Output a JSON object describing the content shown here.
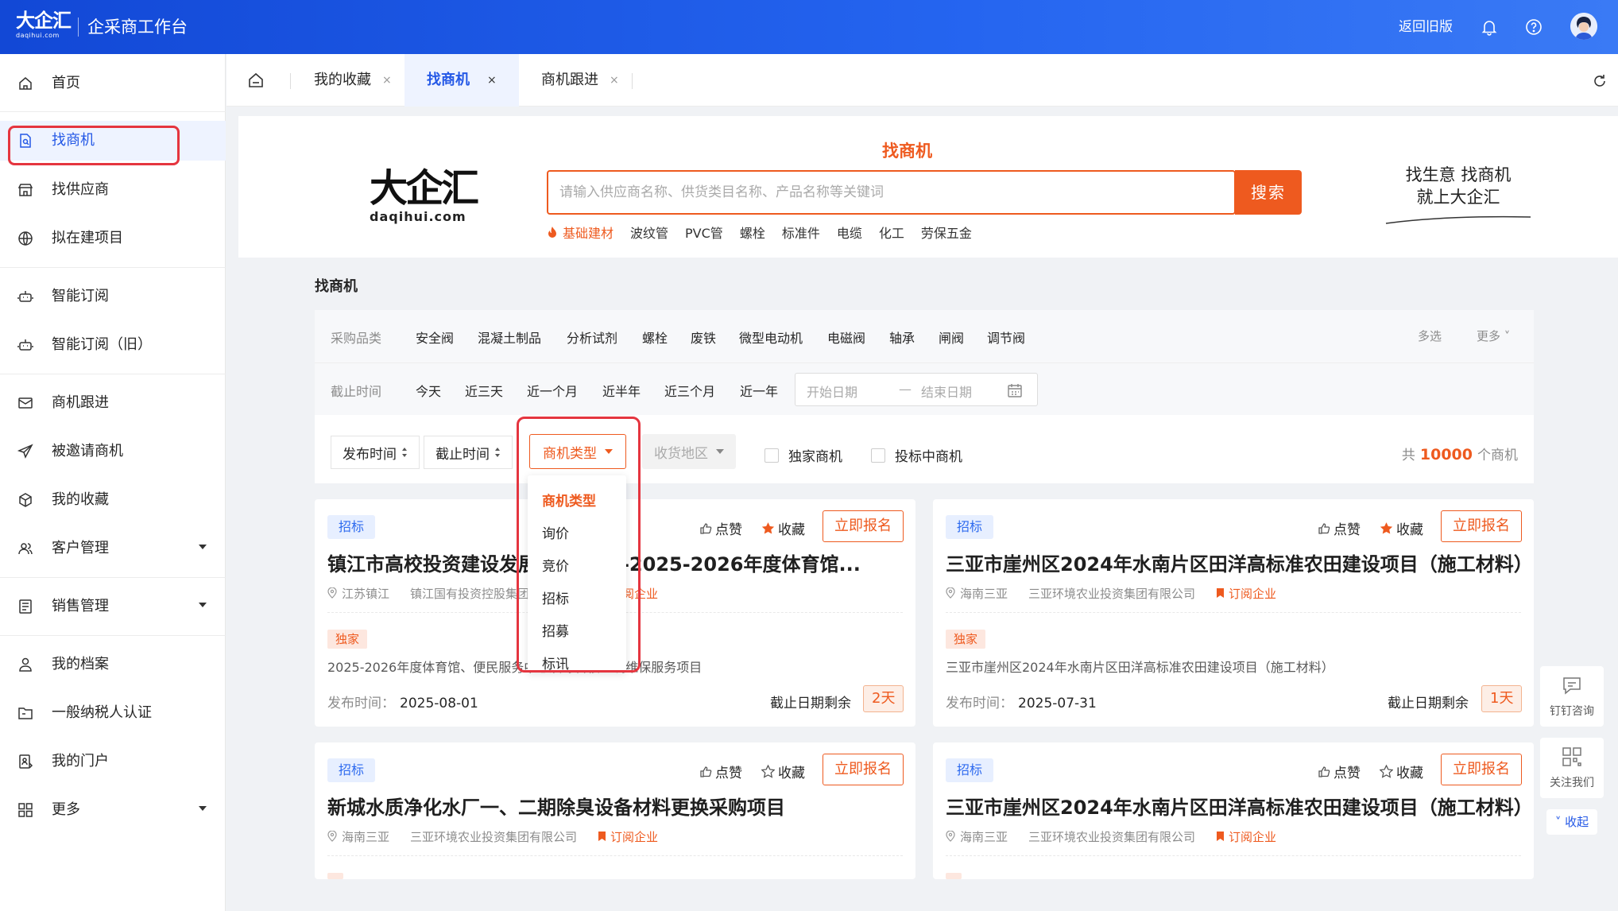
{
  "header": {
    "logo_text": "大企汇",
    "logo_sub": "daqihui.com",
    "app_title": "企采商工作台",
    "back_old": "返回旧版"
  },
  "sidebar": {
    "items": [
      {
        "label": "首页",
        "icon": "home-icon"
      },
      {
        "label": "找商机",
        "icon": "search-document-icon"
      },
      {
        "label": "找供应商",
        "icon": "store-icon"
      },
      {
        "label": "拟在建项目",
        "icon": "globe-icon"
      },
      {
        "label": "智能订阅",
        "icon": "robot-icon"
      },
      {
        "label": "智能订阅（旧）",
        "icon": "robot-icon"
      },
      {
        "label": "商机跟进",
        "icon": "mail-icon"
      },
      {
        "label": "被邀请商机",
        "icon": "send-icon"
      },
      {
        "label": "我的收藏",
        "icon": "cube-icon"
      },
      {
        "label": "客户管理",
        "icon": "users-icon"
      },
      {
        "label": "销售管理",
        "icon": "list-icon"
      },
      {
        "label": "我的档案",
        "icon": "user-icon"
      },
      {
        "label": "一般纳税人认证",
        "icon": "folder-icon"
      },
      {
        "label": "我的门户",
        "icon": "portal-icon"
      },
      {
        "label": "更多",
        "icon": "grid-icon"
      }
    ]
  },
  "tabs": [
    {
      "label": "我的收藏",
      "close": "×"
    },
    {
      "label": "找商机",
      "close": "×"
    },
    {
      "label": "商机跟进",
      "close": "×"
    }
  ],
  "hero": {
    "logo_text": "大企汇",
    "logo_sub": "daqihui.com",
    "title": "找商机",
    "search_placeholder": "请输入供应商名称、供货类目名称、产品名称等关键词",
    "search_button": "搜索",
    "hot_words": [
      "基础建材",
      "波纹管",
      "PVC管",
      "螺栓",
      "标准件",
      "电缆",
      "化工",
      "劳保五金"
    ],
    "slogan_line1": "找生意 找商机",
    "slogan_line2": "就上大企汇"
  },
  "section_title": "找商机",
  "filters": {
    "category_label": "采购品类",
    "categories": [
      "安全阀",
      "混凝土制品",
      "分析试剂",
      "螺栓",
      "废铁",
      "微型电动机",
      "电磁阀",
      "轴承",
      "闸阀",
      "调节阀"
    ],
    "multi_select": "多选",
    "more": "更多",
    "deadline_label": "截止时间",
    "deadline_options": [
      "今天",
      "近三天",
      "近一个月",
      "近半年",
      "近三个月",
      "近一年"
    ],
    "start_placeholder": "开始日期",
    "dash": "—",
    "end_placeholder": "结束日期"
  },
  "sort": {
    "publish_time": "发布时间",
    "deadline": "截止时间",
    "type": "商机类型",
    "region": "收货地区",
    "exclusive": "独家商机",
    "bidding": "投标中商机",
    "count_prefix": "共",
    "count": "10000",
    "count_suffix": "个商机"
  },
  "type_dropdown": {
    "options": [
      "商机类型",
      "询价",
      "竞价",
      "招标",
      "招募",
      "标讯"
    ],
    "selected": "商机类型"
  },
  "cards": [
    {
      "tag": "招标",
      "like": "点赞",
      "fav": "收藏",
      "apply": "立即报名",
      "title": "镇江市高校投资建设发展有限公司--2025-2026年度体育馆...",
      "location": "江苏镇江",
      "company": "镇江国有投资控股集团有限公司",
      "subscribe": "订阅企业",
      "exclusive": "独家",
      "desc": "2025-2026年度体育馆、便民服务中心及综合楼空调维保服务项目",
      "pub_label": "发布时间：",
      "pub_date": "2025-08-01",
      "deadline_label": "截止日期剩余",
      "days": "2天"
    },
    {
      "tag": "招标",
      "like": "点赞",
      "fav": "收藏",
      "apply": "立即报名",
      "title": "三亚市崖州区2024年水南片区田洋高标准农田建设项目（施工材料）",
      "location": "海南三亚",
      "company": "三亚环境农业投资集团有限公司",
      "subscribe": "订阅企业",
      "exclusive": "独家",
      "desc": "三亚市崖州区2024年水南片区田洋高标准农田建设项目（施工材料）",
      "pub_label": "发布时间：",
      "pub_date": "2025-07-31",
      "deadline_label": "截止日期剩余",
      "days": "1天"
    },
    {
      "tag": "招标",
      "like": "点赞",
      "fav": "收藏",
      "apply": "立即报名",
      "title": "新城水质净化水厂一、二期除臭设备材料更换采购项目",
      "location": "海南三亚",
      "company": "三亚环境农业投资集团有限公司",
      "subscribe": "订阅企业"
    },
    {
      "tag": "招标",
      "like": "点赞",
      "fav": "收藏",
      "apply": "立即报名",
      "title": "三亚市崖州区2024年水南片区田洋高标准农田建设项目（施工材料）",
      "location": "海南三亚",
      "company": "三亚环境农业投资集团有限公司",
      "subscribe": "订阅企业"
    }
  ],
  "float": {
    "dingtalk": "钉钉咨询",
    "follow": "关注我们",
    "collapse": "收起"
  },
  "colors": {
    "primary_blue": "#2458e6",
    "accent_orange": "#ee5a1f",
    "highlight_red": "#e5353f"
  }
}
